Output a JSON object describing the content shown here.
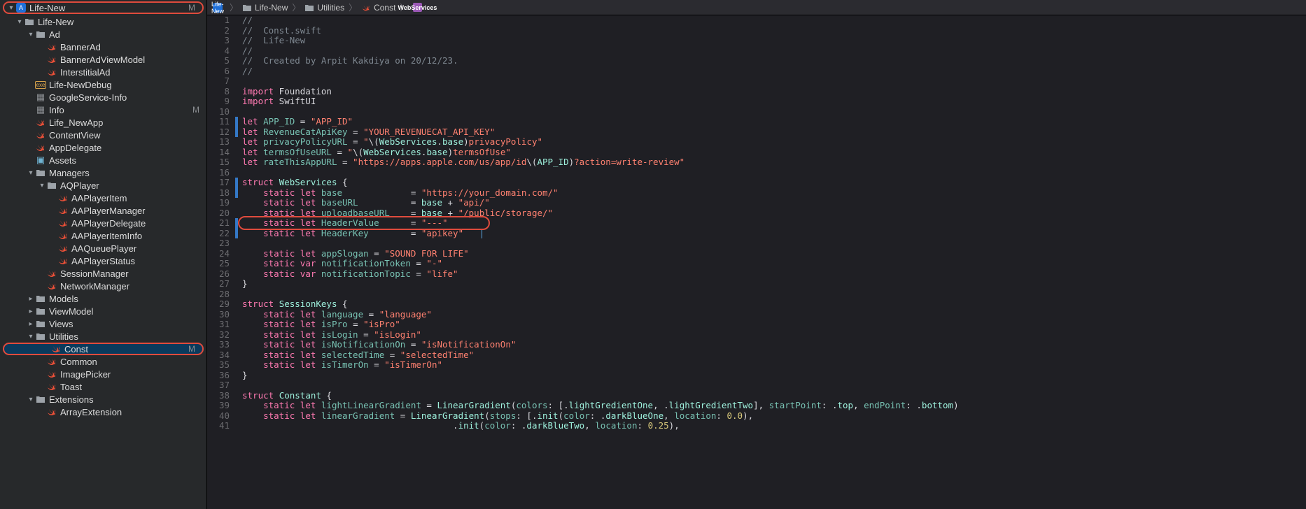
{
  "sidebar": {
    "root": {
      "label": "Life-New",
      "badge": "M"
    },
    "items": [
      {
        "indent": 1,
        "disc": "▾",
        "kind": "folder",
        "label": "Life-New"
      },
      {
        "indent": 2,
        "disc": "▾",
        "kind": "folder",
        "label": "Ad"
      },
      {
        "indent": 3,
        "kind": "swift",
        "label": "BannerAd"
      },
      {
        "indent": 3,
        "kind": "swift",
        "label": "BannerAdViewModel"
      },
      {
        "indent": 3,
        "kind": "swift",
        "label": "InterstitialAd"
      },
      {
        "indent": 2,
        "kind": "debug",
        "label": "Life-NewDebug"
      },
      {
        "indent": 2,
        "kind": "plist",
        "label": "GoogleService-Info"
      },
      {
        "indent": 2,
        "kind": "plist",
        "label": "Info",
        "badge": "M"
      },
      {
        "indent": 2,
        "kind": "swift",
        "label": "Life_NewApp"
      },
      {
        "indent": 2,
        "kind": "swift",
        "label": "ContentView"
      },
      {
        "indent": 2,
        "kind": "swift",
        "label": "AppDelegate"
      },
      {
        "indent": 2,
        "kind": "assets",
        "label": "Assets"
      },
      {
        "indent": 2,
        "disc": "▾",
        "kind": "folder",
        "label": "Managers"
      },
      {
        "indent": 3,
        "disc": "▾",
        "kind": "folder",
        "label": "AQPlayer"
      },
      {
        "indent": 4,
        "kind": "swift",
        "label": "AAPlayerItem"
      },
      {
        "indent": 4,
        "kind": "swift",
        "label": "AAPlayerManager"
      },
      {
        "indent": 4,
        "kind": "swift",
        "label": "AAPlayerDelegate"
      },
      {
        "indent": 4,
        "kind": "swift",
        "label": "AAPlayerItemInfo"
      },
      {
        "indent": 4,
        "kind": "swift",
        "label": "AAQueuePlayer"
      },
      {
        "indent": 4,
        "kind": "swift",
        "label": "AAPlayerStatus"
      },
      {
        "indent": 3,
        "kind": "swift",
        "label": "SessionManager"
      },
      {
        "indent": 3,
        "kind": "swift",
        "label": "NetworkManager"
      },
      {
        "indent": 2,
        "disc": "▸",
        "kind": "folder",
        "label": "Models"
      },
      {
        "indent": 2,
        "disc": "▸",
        "kind": "folder",
        "label": "ViewModel"
      },
      {
        "indent": 2,
        "disc": "▸",
        "kind": "folder",
        "label": "Views"
      },
      {
        "indent": 2,
        "disc": "▾",
        "kind": "folder",
        "label": "Utilities"
      },
      {
        "indent": 3,
        "kind": "swift",
        "label": "Const",
        "badge": "M",
        "selected": true,
        "redring": true
      },
      {
        "indent": 3,
        "kind": "swift",
        "label": "Common"
      },
      {
        "indent": 3,
        "kind": "swift",
        "label": "ImagePicker"
      },
      {
        "indent": 3,
        "kind": "swift",
        "label": "Toast"
      },
      {
        "indent": 2,
        "disc": "▾",
        "kind": "folder",
        "label": "Extensions"
      },
      {
        "indent": 3,
        "kind": "swift",
        "label": "ArrayExtension"
      }
    ]
  },
  "breadcrumb": [
    {
      "kind": "app",
      "label": "Life-New"
    },
    {
      "kind": "folder",
      "label": "Life-New"
    },
    {
      "kind": "folder",
      "label": "Utilities"
    },
    {
      "kind": "swift",
      "label": "Const"
    },
    {
      "kind": "struct",
      "label": "WebServices"
    }
  ],
  "code": {
    "lines": [
      {
        "n": 1,
        "t": "comment",
        "text": "//"
      },
      {
        "n": 2,
        "t": "comment",
        "text": "//  Const.swift"
      },
      {
        "n": 3,
        "t": "comment",
        "text": "//  Life-New"
      },
      {
        "n": 4,
        "t": "comment",
        "text": "//"
      },
      {
        "n": 5,
        "t": "comment",
        "text": "//  Created by Arpit Kakdiya on 20/12/23."
      },
      {
        "n": 6,
        "t": "comment",
        "text": "//"
      },
      {
        "n": 7,
        "t": "blank",
        "text": ""
      },
      {
        "n": 8,
        "t": "import",
        "kw": "import",
        "rest": " Foundation"
      },
      {
        "n": 9,
        "t": "import",
        "kw": "import",
        "rest": " SwiftUI"
      },
      {
        "n": 10,
        "t": "blank",
        "text": ""
      },
      {
        "n": 11,
        "t": "let",
        "mark": true,
        "name": "APP_ID",
        "rest": " = ",
        "str": "\"APP_ID\""
      },
      {
        "n": 12,
        "t": "let",
        "mark": true,
        "name": "RevenueCatApiKey",
        "rest": " = ",
        "str": "\"YOUR_REVENUECAT_API_KEY\""
      },
      {
        "n": 13,
        "t": "expr",
        "raw": true,
        "html": "<span class='tok-keyword'>let</span> <span class='tok-ident'>privacyPolicyURL</span> = <span class='tok-string'>\"</span>\\(<span class='tok-type'>WebServices</span>.<span class='tok-prop'>base</span>)<span class='tok-string'>privacyPolicy\"</span>"
      },
      {
        "n": 14,
        "t": "expr",
        "raw": true,
        "html": "<span class='tok-keyword'>let</span> <span class='tok-ident'>termsOfUseURL</span> = <span class='tok-string'>\"</span>\\(<span class='tok-type'>WebServices</span>.<span class='tok-prop'>base</span>)<span class='tok-string'>termsOfUse\"</span>"
      },
      {
        "n": 15,
        "t": "expr",
        "raw": true,
        "html": "<span class='tok-keyword'>let</span> <span class='tok-ident'>rateThisAppURL</span> = <span class='tok-string'>\"https://apps.apple.com/us/app/id</span>\\(<span class='tok-type'>APP_ID</span>)<span class='tok-string'>?action=write-review\"</span>"
      },
      {
        "n": 16,
        "t": "blank",
        "text": ""
      },
      {
        "n": 17,
        "t": "expr",
        "mark": true,
        "raw": true,
        "html": "<span class='tok-keyword'>struct</span> <span class='tok-type'>WebServices</span> {"
      },
      {
        "n": 18,
        "t": "slet",
        "mark": true,
        "name": "base",
        "pad": "             ",
        "eq": "= ",
        "str": "\"https://your_domain.com/\""
      },
      {
        "n": 19,
        "t": "expr",
        "raw": true,
        "html": "    <span class='tok-keyword'>static</span> <span class='tok-keyword'>let</span> <span class='tok-ident'>baseURL</span>          = <span class='tok-prop'>base</span> + <span class='tok-string'>\"api/\"</span>"
      },
      {
        "n": 20,
        "t": "expr",
        "raw": true,
        "html": "    <span class='tok-keyword'>static</span> <span class='tok-keyword'>let</span> <span class='tok-ident'>uploadbaseURL</span>    = <span class='tok-prop'>base</span> + <span class='tok-string'>\"/public/storage/\"</span>"
      },
      {
        "n": 21,
        "t": "slet",
        "mark": true,
        "name": "HeaderValue",
        "pad": "      ",
        "eq": "= ",
        "str": "\"---\""
      },
      {
        "n": 22,
        "t": "slet",
        "mark": true,
        "name": "HeaderKey",
        "pad": "        ",
        "eq": "= ",
        "str": "\"apikey\"",
        "cursor": true
      },
      {
        "n": 23,
        "t": "blank",
        "text": ""
      },
      {
        "n": 24,
        "t": "slet2",
        "name": "appSlogan",
        "rest": " = ",
        "str": "\"SOUND FOR LIFE\""
      },
      {
        "n": 25,
        "t": "svar",
        "name": "notificationToken",
        "rest": " = ",
        "str": "\"-\""
      },
      {
        "n": 26,
        "t": "svar",
        "name": "notificationTopic",
        "rest": " = ",
        "str": "\"life\""
      },
      {
        "n": 27,
        "t": "plain",
        "text": "}"
      },
      {
        "n": 28,
        "t": "blank",
        "text": ""
      },
      {
        "n": 29,
        "t": "expr",
        "raw": true,
        "html": "<span class='tok-keyword'>struct</span> <span class='tok-type'>SessionKeys</span> {"
      },
      {
        "n": 30,
        "t": "slet2",
        "name": "language",
        "rest": " = ",
        "str": "\"language\""
      },
      {
        "n": 31,
        "t": "slet2",
        "name": "isPro",
        "rest": " = ",
        "str": "\"isPro\""
      },
      {
        "n": 32,
        "t": "slet2",
        "name": "isLogin",
        "rest": " = ",
        "str": "\"isLogin\""
      },
      {
        "n": 33,
        "t": "slet2",
        "name": "isNotificationOn",
        "rest": " = ",
        "str": "\"isNotificationOn\""
      },
      {
        "n": 34,
        "t": "slet2",
        "name": "selectedTime",
        "rest": " = ",
        "str": "\"selectedTime\""
      },
      {
        "n": 35,
        "t": "slet2",
        "name": "isTimerOn",
        "rest": " = ",
        "str": "\"isTimerOn\""
      },
      {
        "n": 36,
        "t": "plain",
        "text": "}"
      },
      {
        "n": 37,
        "t": "blank",
        "text": ""
      },
      {
        "n": 38,
        "t": "expr",
        "raw": true,
        "html": "<span class='tok-keyword'>struct</span> <span class='tok-type'>Constant</span> {"
      },
      {
        "n": 39,
        "t": "expr",
        "raw": true,
        "html": "    <span class='tok-keyword'>static</span> <span class='tok-keyword'>let</span> <span class='tok-ident'>lightLinearGradient</span> = <span class='tok-type'>LinearGradient</span>(<span class='tok-ident'>colors</span>: [.<span class='tok-prop'>lightGredientOne</span>, .<span class='tok-prop'>lightGredientTwo</span>], <span class='tok-ident'>startPoint</span>: .<span class='tok-prop'>top</span>, <span class='tok-ident'>endPoint</span>: .<span class='tok-prop'>bottom</span>)"
      },
      {
        "n": 40,
        "t": "expr",
        "raw": true,
        "html": "    <span class='tok-keyword'>static</span> <span class='tok-keyword'>let</span> <span class='tok-ident'>linearGradient</span> = <span class='tok-type'>LinearGradient</span>(<span class='tok-ident'>stops</span>: [.<span class='tok-prop'>init</span>(<span class='tok-ident'>color</span>: .<span class='tok-prop'>darkBlueOne</span>, <span class='tok-ident'>location</span>: <span class='tok-num'>0.0</span>),"
      },
      {
        "n": 41,
        "t": "expr",
        "raw": true,
        "html": "                                        .<span class='tok-prop'>init</span>(<span class='tok-ident'>color</span>: .<span class='tok-prop'>darkBlueTwo</span>, <span class='tok-ident'>location</span>: <span class='tok-num'>0.25</span>),"
      }
    ]
  }
}
